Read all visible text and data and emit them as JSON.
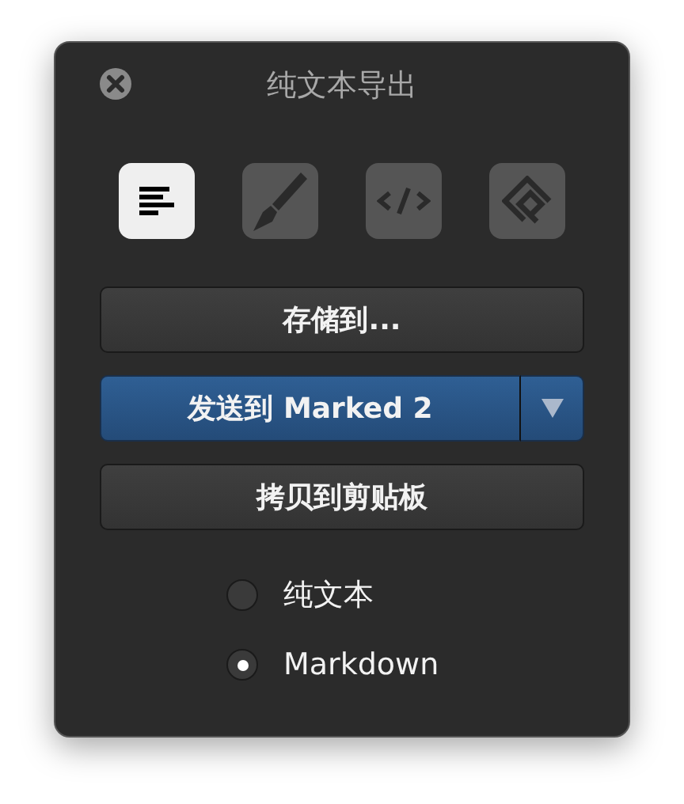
{
  "window": {
    "title": "纯文本导出"
  },
  "formats": [
    {
      "kind": "text",
      "selected": true
    },
    {
      "kind": "pen",
      "selected": false
    },
    {
      "kind": "code",
      "selected": false
    },
    {
      "kind": "epub",
      "selected": false
    }
  ],
  "actions": [
    {
      "label": "存储到...",
      "kind": "plain"
    },
    {
      "label": "发送到 Marked 2",
      "kind": "split"
    },
    {
      "label": "拷贝到剪贴板",
      "kind": "plain"
    }
  ],
  "options": [
    {
      "label": "纯文本",
      "selected": false
    },
    {
      "label": "Markdown",
      "selected": true
    }
  ]
}
